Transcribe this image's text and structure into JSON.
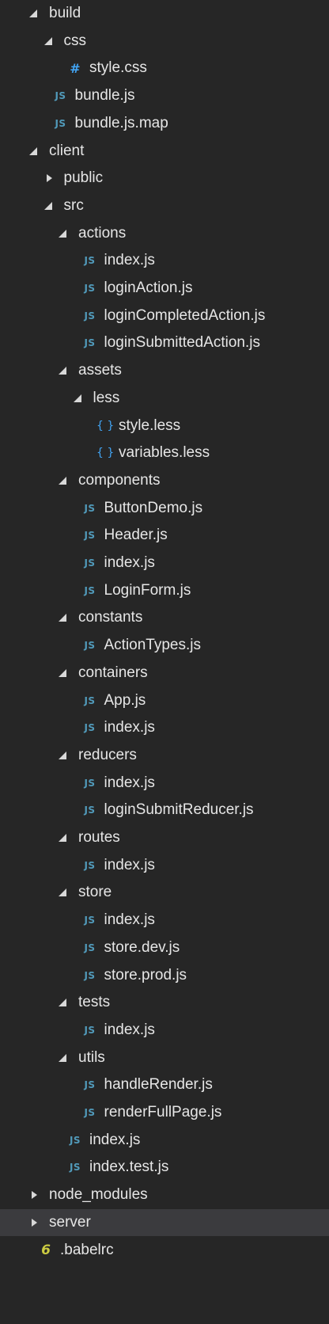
{
  "explorer": {
    "items": [
      {
        "label": "build",
        "kind": "folder",
        "expanded": true,
        "depth": 0
      },
      {
        "label": "css",
        "kind": "folder",
        "expanded": true,
        "depth": 1
      },
      {
        "label": "style.css",
        "kind": "file",
        "icon": "css-hash-icon",
        "glyph": "#",
        "depth": 2
      },
      {
        "label": "bundle.js",
        "kind": "file",
        "icon": "js-file-icon",
        "glyph": "JS",
        "depth": 1
      },
      {
        "label": "bundle.js.map",
        "kind": "file",
        "icon": "js-file-icon",
        "glyph": "JS",
        "depth": 1
      },
      {
        "label": "client",
        "kind": "folder",
        "expanded": true,
        "depth": 0
      },
      {
        "label": "public",
        "kind": "folder",
        "expanded": false,
        "depth": 1
      },
      {
        "label": "src",
        "kind": "folder",
        "expanded": true,
        "depth": 1
      },
      {
        "label": "actions",
        "kind": "folder",
        "expanded": true,
        "depth": 2
      },
      {
        "label": "index.js",
        "kind": "file",
        "icon": "js-file-icon",
        "glyph": "JS",
        "depth": 3
      },
      {
        "label": "loginAction.js",
        "kind": "file",
        "icon": "js-file-icon",
        "glyph": "JS",
        "depth": 3
      },
      {
        "label": "loginCompletedAction.js",
        "kind": "file",
        "icon": "js-file-icon",
        "glyph": "JS",
        "depth": 3
      },
      {
        "label": "loginSubmittedAction.js",
        "kind": "file",
        "icon": "js-file-icon",
        "glyph": "JS",
        "depth": 3
      },
      {
        "label": "assets",
        "kind": "folder",
        "expanded": true,
        "depth": 2
      },
      {
        "label": "less",
        "kind": "folder",
        "expanded": true,
        "depth": 3
      },
      {
        "label": "style.less",
        "kind": "file",
        "icon": "less-braces-icon",
        "glyph": "{ }",
        "depth": 4
      },
      {
        "label": "variables.less",
        "kind": "file",
        "icon": "less-braces-icon",
        "glyph": "{ }",
        "depth": 4
      },
      {
        "label": "components",
        "kind": "folder",
        "expanded": true,
        "depth": 2
      },
      {
        "label": "ButtonDemo.js",
        "kind": "file",
        "icon": "js-file-icon",
        "glyph": "JS",
        "depth": 3
      },
      {
        "label": "Header.js",
        "kind": "file",
        "icon": "js-file-icon",
        "glyph": "JS",
        "depth": 3
      },
      {
        "label": "index.js",
        "kind": "file",
        "icon": "js-file-icon",
        "glyph": "JS",
        "depth": 3
      },
      {
        "label": "LoginForm.js",
        "kind": "file",
        "icon": "js-file-icon",
        "glyph": "JS",
        "depth": 3
      },
      {
        "label": "constants",
        "kind": "folder",
        "expanded": true,
        "depth": 2
      },
      {
        "label": "ActionTypes.js",
        "kind": "file",
        "icon": "js-file-icon",
        "glyph": "JS",
        "depth": 3
      },
      {
        "label": "containers",
        "kind": "folder",
        "expanded": true,
        "depth": 2
      },
      {
        "label": "App.js",
        "kind": "file",
        "icon": "js-file-icon",
        "glyph": "JS",
        "depth": 3
      },
      {
        "label": "index.js",
        "kind": "file",
        "icon": "js-file-icon",
        "glyph": "JS",
        "depth": 3
      },
      {
        "label": "reducers",
        "kind": "folder",
        "expanded": true,
        "depth": 2
      },
      {
        "label": "index.js",
        "kind": "file",
        "icon": "js-file-icon",
        "glyph": "JS",
        "depth": 3
      },
      {
        "label": "loginSubmitReducer.js",
        "kind": "file",
        "icon": "js-file-icon",
        "glyph": "JS",
        "depth": 3
      },
      {
        "label": "routes",
        "kind": "folder",
        "expanded": true,
        "depth": 2
      },
      {
        "label": "index.js",
        "kind": "file",
        "icon": "js-file-icon",
        "glyph": "JS",
        "depth": 3
      },
      {
        "label": "store",
        "kind": "folder",
        "expanded": true,
        "depth": 2
      },
      {
        "label": "index.js",
        "kind": "file",
        "icon": "js-file-icon",
        "glyph": "JS",
        "depth": 3
      },
      {
        "label": "store.dev.js",
        "kind": "file",
        "icon": "js-file-icon",
        "glyph": "JS",
        "depth": 3
      },
      {
        "label": "store.prod.js",
        "kind": "file",
        "icon": "js-file-icon",
        "glyph": "JS",
        "depth": 3
      },
      {
        "label": "tests",
        "kind": "folder",
        "expanded": true,
        "depth": 2
      },
      {
        "label": "index.js",
        "kind": "file",
        "icon": "js-file-icon",
        "glyph": "JS",
        "depth": 3
      },
      {
        "label": "utils",
        "kind": "folder",
        "expanded": true,
        "depth": 2
      },
      {
        "label": "handleRender.js",
        "kind": "file",
        "icon": "js-file-icon",
        "glyph": "JS",
        "depth": 3
      },
      {
        "label": "renderFullPage.js",
        "kind": "file",
        "icon": "js-file-icon",
        "glyph": "JS",
        "depth": 3
      },
      {
        "label": "index.js",
        "kind": "file",
        "icon": "js-file-icon",
        "glyph": "JS",
        "depth": 2
      },
      {
        "label": "index.test.js",
        "kind": "file",
        "icon": "js-file-icon",
        "glyph": "JS",
        "depth": 2
      },
      {
        "label": "node_modules",
        "kind": "folder",
        "expanded": false,
        "depth": 0
      },
      {
        "label": "server",
        "kind": "folder",
        "expanded": false,
        "depth": 0,
        "selected": true
      },
      {
        "label": ".babelrc",
        "kind": "file",
        "icon": "babel-file-icon",
        "glyph": "6",
        "depth": 0
      }
    ]
  },
  "colors": {
    "background": "#262626",
    "selected_row": "#3b3b3e",
    "text": "#e6e6e6",
    "js_icon": "#519aba",
    "css_icon": "#42a5f5",
    "babel_icon": "#cbcb41"
  }
}
